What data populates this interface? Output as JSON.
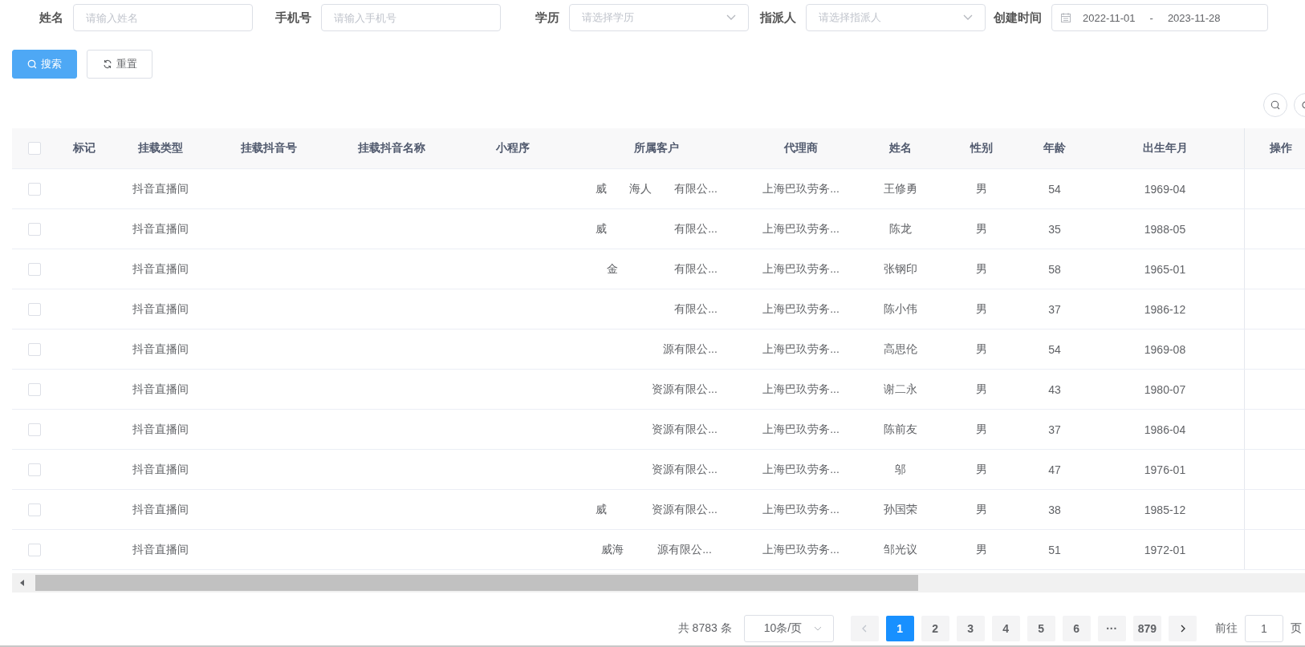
{
  "filters": [
    {
      "kind": "input",
      "label": "姓名",
      "placeholder": "请输入姓名"
    },
    {
      "kind": "input",
      "label": "手机号",
      "placeholder": "请输入手机号"
    },
    {
      "kind": "select",
      "label": "学历",
      "placeholder": "请选择学历"
    },
    {
      "kind": "select",
      "label": "指派人",
      "placeholder": "请选择指派人"
    },
    {
      "kind": "daterange",
      "label": "创建时间",
      "start": "2022-11-01",
      "separator": "-",
      "end": "2023-11-28"
    }
  ],
  "buttons": [
    {
      "kind": "primary",
      "label": "搜索"
    },
    {
      "kind": "plain",
      "label": "重置"
    }
  ],
  "table": {
    "select_all_checked": false,
    "columns": [
      "标记",
      "挂载类型",
      "挂载抖音号",
      "挂载抖音名称",
      "小程序",
      "所属客户",
      "代理商",
      "姓名",
      "性别",
      "年龄",
      "出生年月",
      "操作"
    ],
    "rows": [
      {
        "checked": false,
        "cells": [
          "",
          "抖音直播间",
          "",
          "",
          "",
          "威　　海人　　有限公...",
          "上海巴玖劳务...",
          "王修勇",
          "男",
          "54",
          "1969-04",
          ""
        ]
      },
      {
        "checked": false,
        "cells": [
          "",
          "抖音直播间",
          "",
          "",
          "",
          "威　　　　　　有限公...",
          "上海巴玖劳务...",
          "陈龙",
          "男",
          "35",
          "1988-05",
          ""
        ]
      },
      {
        "checked": false,
        "cells": [
          "",
          "抖音直播间",
          "",
          "",
          "",
          "　金　　　　　有限公...",
          "上海巴玖劳务...",
          "张钢印",
          "男",
          "58",
          "1965-01",
          ""
        ]
      },
      {
        "checked": false,
        "cells": [
          "",
          "抖音直播间",
          "",
          "",
          "",
          "　　　　　　　有限公...",
          "上海巴玖劳务...",
          "陈小伟",
          "男",
          "37",
          "1986-12",
          ""
        ]
      },
      {
        "checked": false,
        "cells": [
          "",
          "抖音直播间",
          "",
          "",
          "",
          "　　　　　　源有限公...",
          "上海巴玖劳务...",
          "高思伦",
          "男",
          "54",
          "1969-08",
          ""
        ]
      },
      {
        "checked": false,
        "cells": [
          "",
          "抖音直播间",
          "",
          "",
          "",
          "　　　　　资源有限公...",
          "上海巴玖劳务...",
          "谢二永",
          "男",
          "43",
          "1980-07",
          ""
        ]
      },
      {
        "checked": false,
        "cells": [
          "",
          "抖音直播间",
          "",
          "",
          "",
          "　　　　　资源有限公...",
          "上海巴玖劳务...",
          "陈前友",
          "男",
          "37",
          "1986-04",
          ""
        ]
      },
      {
        "checked": false,
        "cells": [
          "",
          "抖音直播间",
          "",
          "",
          "",
          "　　　　　资源有限公...",
          "上海巴玖劳务...",
          "邬",
          "男",
          "47",
          "1976-01",
          ""
        ]
      },
      {
        "checked": false,
        "cells": [
          "",
          "抖音直播间",
          "",
          "",
          "",
          "威　　　　资源有限公...",
          "上海巴玖劳务...",
          "孙国荣",
          "男",
          "38",
          "1985-12",
          ""
        ]
      },
      {
        "checked": false,
        "cells": [
          "",
          "抖音直播间",
          "",
          "",
          "",
          "威海　　　源有限公...",
          "上海巴玖劳务...",
          "邹光议",
          "男",
          "51",
          "1972-01",
          ""
        ]
      }
    ]
  },
  "pagination": {
    "total": "共 8783 条",
    "page_size": "10条/页",
    "prev_disabled": true,
    "pages": [
      {
        "label": "1",
        "selected": true
      },
      {
        "label": "2",
        "selected": false
      },
      {
        "label": "3",
        "selected": false
      },
      {
        "label": "4",
        "selected": false
      },
      {
        "label": "5",
        "selected": false
      },
      {
        "label": "6",
        "selected": false
      },
      {
        "label": "···",
        "selected": false
      },
      {
        "label": "879",
        "selected": false
      }
    ],
    "goto_label": "前往",
    "goto_value": "1",
    "goto_suffix": "页"
  }
}
